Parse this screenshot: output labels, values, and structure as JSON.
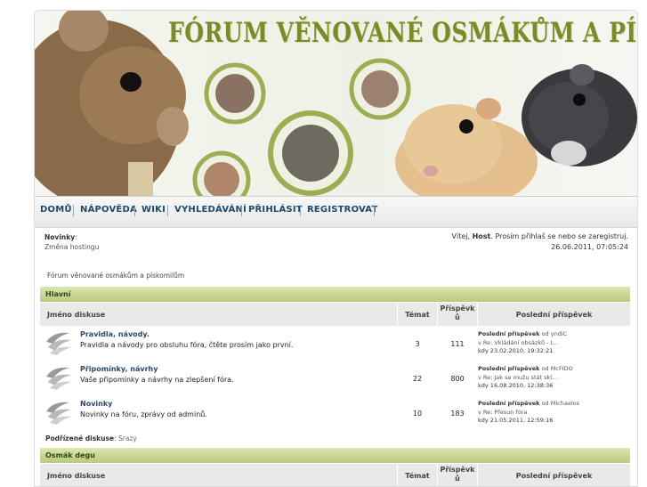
{
  "header": {
    "title": "FÓRUM VĚNOVANÉ OSMÁKŮM A PÍSKOMILŮM"
  },
  "nav": {
    "items": [
      "DOMŮ",
      "NÁPOVĚDA",
      "WIKI",
      "VYHLEDÁVÁNÍ",
      "PŘIHLÁSIT",
      "REGISTROVAT"
    ]
  },
  "news": {
    "label": "Novinky",
    "colon": ":",
    "item": "Změna hostingu"
  },
  "welcome": {
    "prefix": "Vítej,",
    "user": "Host",
    "suffix": ". Prosím přihlaš se nebo se zaregistruj.",
    "datetime": "26.06.2011, 07:05:24"
  },
  "breadcrumb": "Fórum věnované osmákům a pískomilům",
  "columns": {
    "name": "Jméno diskuse",
    "topics": "Témat",
    "posts_line1": "Příspěvk",
    "posts_line2": "ů",
    "last": "Poslední příspěvek"
  },
  "sections": [
    {
      "title": "Hlavní",
      "forums": [
        {
          "title": "Pravidla, návody.",
          "desc": "Pravidla a návody pro obsluhu fóra, čtěte prosím jako první.",
          "topics": "3",
          "posts": "111",
          "last_label": "Poslední příspěvek",
          "last_by": "od",
          "last_user": "yndiC",
          "last_in": "v Re: Vkládání obsázků - I...",
          "last_date": "kdy 23.02.2010, 19:32:21"
        },
        {
          "title": "Připomínky, návrhy",
          "desc": "Vaše připomínky a návrhy na zlepšení fóra.",
          "topics": "22",
          "posts": "800",
          "last_label": "Poslední příspěvek",
          "last_by": "od",
          "last_user": "McFIDO",
          "last_in": "v Re: Jak se mužu stát skl...",
          "last_date": "kdy 16.08.2010, 12:38:36"
        },
        {
          "title": "Novinky",
          "desc": "Novinky na fóru, zprávy od adminů.",
          "topics": "10",
          "posts": "183",
          "last_label": "Poslední příspěvek",
          "last_by": "od",
          "last_user": "Michaelos",
          "last_in": "v Re: Přesun fóra",
          "last_date": "kdy 21.05.2011, 12:59:16"
        }
      ],
      "subforums_label": "Podřízené diskuse",
      "subforums": "Srazy"
    },
    {
      "title": "Osmák degu"
    }
  ],
  "colors": {
    "accent_green": "#b9c97c",
    "nav_text": "#1d4a6a",
    "title_green": "#7b8b2a"
  }
}
